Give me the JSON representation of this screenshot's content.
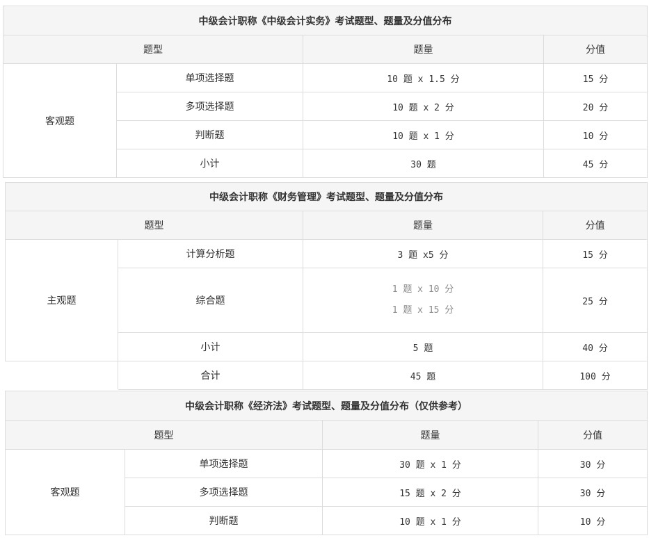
{
  "tables": [
    {
      "title": "中级会计职称《中级会计实务》考试题型、题量及分值分布",
      "headers": [
        "题型",
        "题量",
        "分值"
      ],
      "group": "客观题",
      "rows": [
        {
          "type": "单项选择题",
          "qty": "10 题 x 1.5 分",
          "score": "15 分"
        },
        {
          "type": "多项选择题",
          "qty": "10 题 x 2 分",
          "score": "20 分"
        },
        {
          "type": "判断题",
          "qty": "10 题 x 1 分",
          "score": "10 分"
        },
        {
          "type": "小计",
          "qty": "30 题",
          "score": "45 分"
        }
      ]
    },
    {
      "title": "中级会计职称《财务管理》考试题型、题量及分值分布",
      "headers": [
        "题型",
        "题量",
        "分值"
      ],
      "group": "主观题",
      "rows": [
        {
          "type": "计算分析题",
          "qty": "3 题 x5 分",
          "score": "15 分"
        },
        {
          "type": "综合题",
          "qty_lines": [
            "1 题 x 10 分",
            "1 题 x 15 分"
          ],
          "score": "25 分"
        },
        {
          "type": "小计",
          "qty": "5 题",
          "score": "40 分"
        }
      ],
      "total": {
        "type": "合计",
        "qty": "45 题",
        "score": "100 分"
      }
    },
    {
      "title": "中级会计职称《经济法》考试题型、题量及分值分布（仅供参考）",
      "headers": [
        "题型",
        "题量",
        "分值"
      ],
      "group": "客观题",
      "rows": [
        {
          "type": "单项选择题",
          "qty": "30 题 x 1 分",
          "score": "30 分"
        },
        {
          "type": "多项选择题",
          "qty": "15 题 x 2 分",
          "score": "30 分"
        },
        {
          "type": "判断题",
          "qty": "10 题 x 1 分",
          "score": "10 分"
        }
      ]
    }
  ]
}
